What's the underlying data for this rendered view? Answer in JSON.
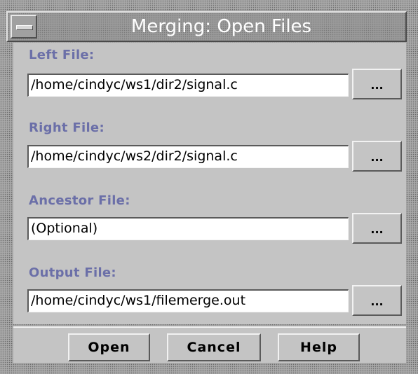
{
  "window": {
    "title": "Merging: Open Files"
  },
  "fields": [
    {
      "label": "Left File:",
      "value": "/home/cindyc/ws1/dir2/signal.c",
      "browse_label": "..."
    },
    {
      "label": "Right File:",
      "value": "/home/cindyc/ws2/dir2/signal.c",
      "browse_label": "..."
    },
    {
      "label": "Ancestor File:",
      "value": "(Optional)",
      "browse_label": "..."
    },
    {
      "label": "Output File:",
      "value": "/home/cindyc/ws1/filemerge.out",
      "browse_label": "..."
    }
  ],
  "buttons": {
    "open": "Open",
    "cancel": "Cancel",
    "help": "Help"
  },
  "colors": {
    "label": "#6b6fa8",
    "panel": "#c4c4c4",
    "title_text": "#ffffff"
  }
}
